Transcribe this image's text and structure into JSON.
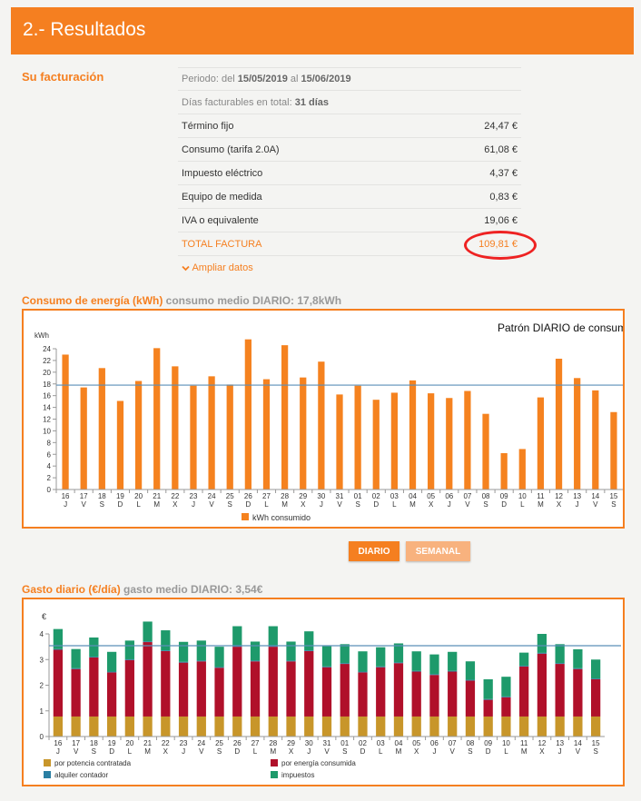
{
  "header": {
    "title": "2.- Resultados"
  },
  "billing": {
    "section_title": "Su facturación",
    "period_prefix": "Periodo: del ",
    "period_from": "15/05/2019",
    "period_mid": " al ",
    "period_to": "15/06/2019",
    "days_prefix": "Días facturables en total: ",
    "days_value": "31 días",
    "items": [
      {
        "label": "Término fijo",
        "value": "24,47 €"
      },
      {
        "label": "Consumo (tarifa 2.0A)",
        "value": "61,08 €"
      },
      {
        "label": "Impuesto eléctrico",
        "value": "4,37 €"
      },
      {
        "label": "Equipo de medida",
        "value": "0,83 €"
      },
      {
        "label": "IVA o equivalente",
        "value": "19,06 €"
      }
    ],
    "total_label": "TOTAL FACTURA",
    "total_value": "109,81 €",
    "expand_label": "Ampliar datos"
  },
  "energy": {
    "title_orange": "Consumo de energía (kWh)",
    "title_gray": " consumo medio DIARIO: 17,8kWh",
    "buttons": {
      "daily": "DIARIO",
      "weekly": "SEMANAL"
    }
  },
  "cost": {
    "title_orange": "Gasto diario (€/día)",
    "title_gray": " gasto medio DIARIO: 3,54€"
  },
  "chart_data": [
    {
      "type": "bar",
      "title": "Patrón DIARIO de consumo",
      "ylabel": "kWh",
      "ylim": [
        0,
        24
      ],
      "yticks": [
        0,
        2,
        4,
        6,
        8,
        10,
        12,
        14,
        16,
        18,
        20,
        22,
        24
      ],
      "categories": [
        "16",
        "17",
        "18",
        "19",
        "20",
        "21",
        "22",
        "23",
        "24",
        "25",
        "26",
        "27",
        "28",
        "29",
        "30",
        "31",
        "01",
        "02",
        "03",
        "04",
        "05",
        "06",
        "07",
        "08",
        "09",
        "10",
        "11",
        "12",
        "13",
        "14",
        "15"
      ],
      "weekdays": [
        "J",
        "V",
        "S",
        "D",
        "L",
        "M",
        "X",
        "J",
        "V",
        "S",
        "D",
        "L",
        "M",
        "X",
        "J",
        "V",
        "S",
        "D",
        "L",
        "M",
        "X",
        "J",
        "V",
        "S",
        "D",
        "L",
        "M",
        "X",
        "J",
        "V",
        "S"
      ],
      "series": [
        {
          "name": "kWh consumido",
          "color": "#f5821f",
          "values": [
            23.0,
            17.4,
            20.7,
            15.1,
            18.5,
            24.1,
            21.0,
            17.7,
            19.3,
            17.9,
            25.6,
            18.8,
            24.6,
            19.1,
            21.8,
            16.2,
            17.7,
            15.3,
            16.5,
            18.6,
            16.4,
            15.6,
            16.8,
            12.9,
            6.2,
            6.9,
            15.7,
            22.3,
            19.0,
            16.9,
            13.2
          ]
        }
      ],
      "average_line": 17.8,
      "average_color": "#5b8fb8",
      "legend_position": "bottom"
    },
    {
      "type": "bar",
      "stacked": true,
      "ylabel": "€",
      "ylim": [
        0,
        4
      ],
      "yticks": [
        0,
        1,
        2,
        3,
        4
      ],
      "categories": [
        "16",
        "17",
        "18",
        "19",
        "20",
        "21",
        "22",
        "23",
        "24",
        "25",
        "26",
        "27",
        "28",
        "29",
        "30",
        "31",
        "01",
        "02",
        "03",
        "04",
        "05",
        "06",
        "07",
        "08",
        "09",
        "10",
        "11",
        "12",
        "13",
        "14",
        "15"
      ],
      "weekdays": [
        "J",
        "V",
        "S",
        "D",
        "L",
        "M",
        "X",
        "J",
        "V",
        "S",
        "D",
        "L",
        "M",
        "X",
        "J",
        "V",
        "S",
        "D",
        "L",
        "M",
        "X",
        "J",
        "V",
        "S",
        "D",
        "L",
        "M",
        "X",
        "J",
        "V",
        "S"
      ],
      "series": [
        {
          "name": "por potencia contratada",
          "color": "#c8962a",
          "values": [
            0.78,
            0.78,
            0.78,
            0.78,
            0.78,
            0.78,
            0.78,
            0.78,
            0.78,
            0.78,
            0.78,
            0.78,
            0.78,
            0.78,
            0.78,
            0.78,
            0.78,
            0.78,
            0.78,
            0.78,
            0.78,
            0.78,
            0.78,
            0.78,
            0.78,
            0.78,
            0.78,
            0.78,
            0.78,
            0.78,
            0.78
          ]
        },
        {
          "name": "por energía consumida",
          "color": "#b0102a",
          "values": [
            2.6,
            1.85,
            2.3,
            1.72,
            2.2,
            2.9,
            2.55,
            2.1,
            2.15,
            1.9,
            2.72,
            2.15,
            2.72,
            2.15,
            2.55,
            1.92,
            2.05,
            1.72,
            1.92,
            2.08,
            1.75,
            1.62,
            1.75,
            1.4,
            0.65,
            0.75,
            1.95,
            2.45,
            2.05,
            1.85,
            1.45
          ]
        },
        {
          "name": "alquiler contador",
          "color": "#2a7fa3",
          "values": [
            0.03,
            0.03,
            0.03,
            0.03,
            0.03,
            0.03,
            0.03,
            0.03,
            0.03,
            0.03,
            0.03,
            0.03,
            0.03,
            0.03,
            0.03,
            0.03,
            0.03,
            0.03,
            0.03,
            0.03,
            0.03,
            0.03,
            0.03,
            0.03,
            0.03,
            0.03,
            0.03,
            0.03,
            0.03,
            0.03,
            0.03
          ]
        },
        {
          "name": "impuestos",
          "color": "#1e9a6b",
          "values": [
            0.78,
            0.75,
            0.75,
            0.77,
            0.73,
            0.77,
            0.78,
            0.78,
            0.78,
            0.79,
            0.77,
            0.74,
            0.77,
            0.74,
            0.74,
            0.79,
            0.74,
            0.79,
            0.75,
            0.74,
            0.76,
            0.77,
            0.74,
            0.72,
            0.77,
            0.77,
            0.51,
            0.74,
            0.74,
            0.74,
            0.74
          ]
        }
      ],
      "average_line": 3.54,
      "average_color": "#5b8fb8",
      "legend_position": "bottom"
    }
  ]
}
